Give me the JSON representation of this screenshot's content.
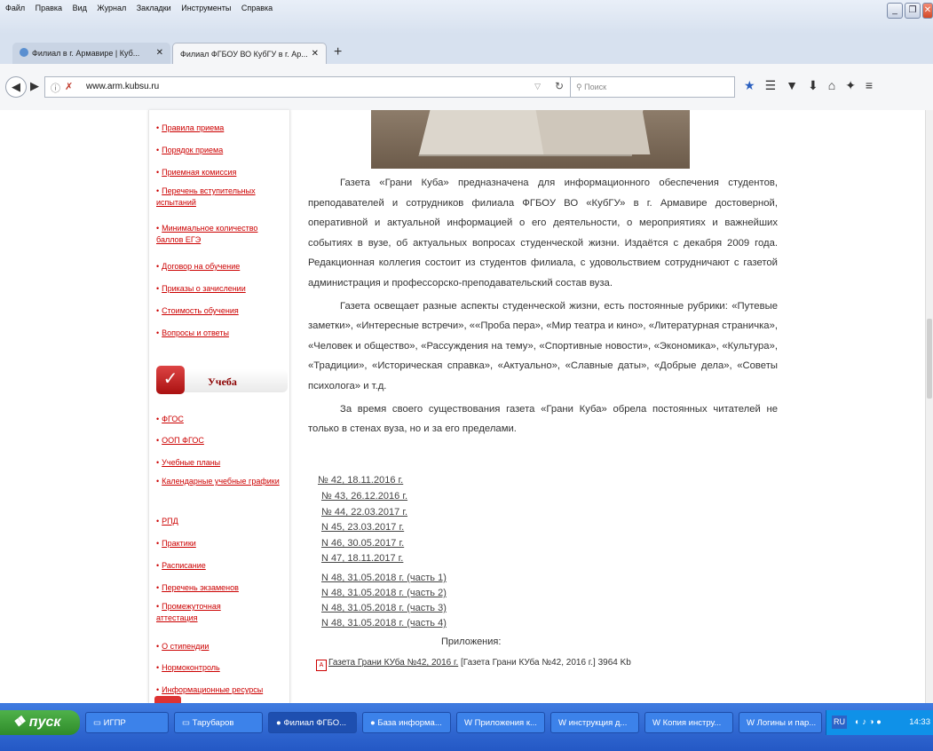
{
  "menubar": {
    "items": [
      "Файл",
      "Правка",
      "Вид",
      "Журнал",
      "Закладки",
      "Инструменты",
      "Справка"
    ]
  },
  "tabs": [
    {
      "label": "Филиал в г. Армавире | Куб..."
    },
    {
      "label": "Филиал ФГБОУ ВО КубГУ в г. Ар..."
    }
  ],
  "navbar": {
    "url": "www.arm.kubsu.ru",
    "search_placeholder": "Поиск"
  },
  "sidebar": {
    "top_items": [
      {
        "label": "Правила приема"
      },
      {
        "label": "Порядок приема"
      },
      {
        "label": "Приемная комиссия"
      },
      {
        "label": "Перечень вступительных испытаний"
      },
      {
        "label": "Минимальное количество баллов ЕГЭ"
      },
      {
        "label": "Договор на обучение"
      },
      {
        "label": "Приказы о зачислении"
      },
      {
        "label": "Стоимость обучения"
      },
      {
        "label": "Вопросы и ответы"
      }
    ],
    "section_title": "Учеба",
    "section_items": [
      {
        "label": "ФГОС"
      },
      {
        "label": "ООП ФГОС"
      },
      {
        "label": "Учебные планы"
      },
      {
        "label": "Календарные учебные графики"
      },
      {
        "label": "РПД"
      },
      {
        "label": "Практики"
      },
      {
        "label": "Расписание"
      },
      {
        "label": "Перечень экзаменов"
      },
      {
        "label": "Промежуточная аттестация"
      },
      {
        "label": "О стипендии"
      },
      {
        "label": "Нормоконтроль"
      },
      {
        "label": "Информационные ресурсы"
      }
    ]
  },
  "main": {
    "paragraphs": [
      "Газета «Грани Куба» предназначена для информационного обеспечения студентов, преподавателей и сотрудников филиала ФГБОУ ВО «КубГУ» в г. Армавире достоверной, оперативной и актуальной информацией о его деятельности, о мероприятиях и важнейших событиях в вузе, об актуальных вопросах студенческой жизни. Издаётся с декабря 2009 года. Редакционная коллегия состоит из студентов филиала, с удовольствием сотрудничают с газетой администрация и профессорско-преподавательский состав вуза.",
      "Газета освещает разные аспекты студенческой жизни, есть постоянные рубрики: «Путевые заметки», «Интересные встречи», ««Проба пера», «Мир театра и кино», «Литературная страничка», «Человек и общество», «Рассуждения на тему», «Спортивные новости», «Экономика», «Культура», «Традиции», «Историческая справка», «Актуально», «Славные даты», «Добрые дела», «Советы психолога» и т.д.",
      "За время своего существования газета «Грани Куба» обрела постоянных читателей не только в стенах вуза, но и за его пределами."
    ],
    "issues": [
      "№ 42,  18.11.2016 г.",
      "№ 43,  26.12.2016 г.",
      "№ 44, 22.03.2017 г.",
      "N 45, 23.03.2017 г.",
      "N 46, 30.05.2017 г.",
      "N 47, 18.11.2017 г.",
      "N 48, 31.05.2018 г. (часть 1)",
      "N 48, 31.05.2018 г. (часть 2)",
      "N 48, 31.05.2018 г. (часть 3)",
      "N 48, 31.05.2018 г. (часть 4)"
    ],
    "appendix_label": "Приложения:",
    "pdf_link": "Газета Грани КУба №42, 2016 г.",
    "pdf_meta": "[Газета Грани КУба №42, 2016 г.] 3964 Kb"
  },
  "taskbar": {
    "start_label": "пуск",
    "buttons": [
      "ИГПР",
      "Тарубаров",
      "Филиал ФГБО...",
      "База информа...",
      "Приложения к...",
      "инструкция д...",
      "Копия инстру...",
      "Логины и пар..."
    ],
    "lang": "RU",
    "time": "14:33"
  }
}
